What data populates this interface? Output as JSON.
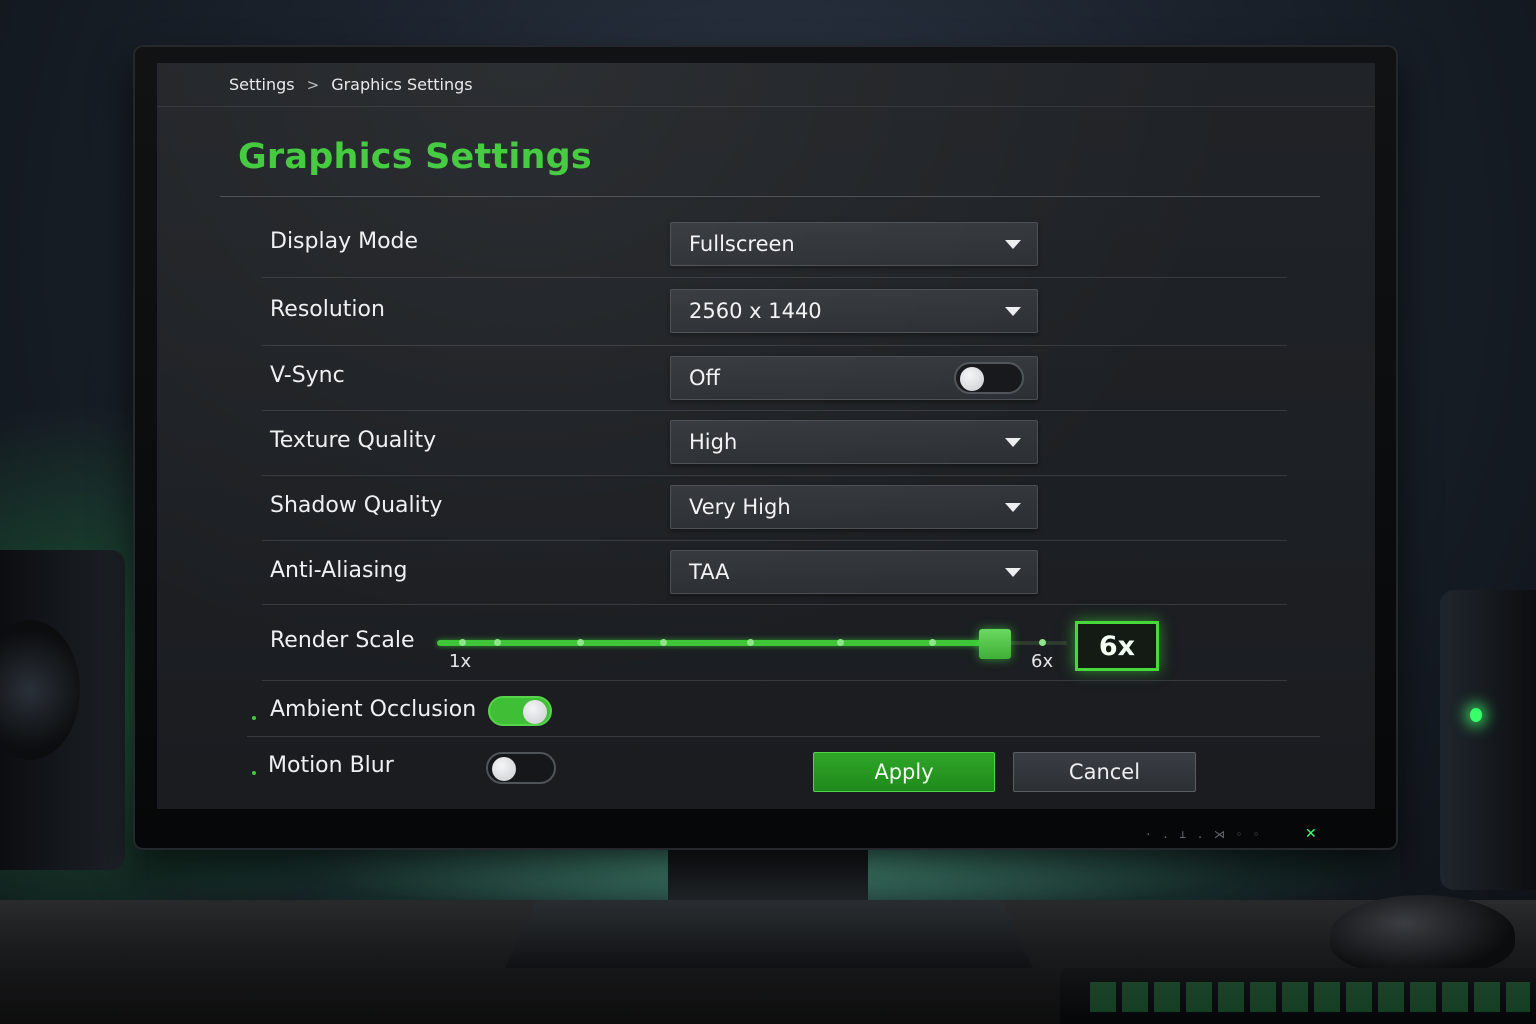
{
  "breadcrumb": {
    "root": "Settings",
    "separator": ">",
    "current": "Graphics Settings"
  },
  "page": {
    "title": "Graphics Settings"
  },
  "settings": {
    "display_mode": {
      "label": "Display Mode",
      "value": "Fullscreen"
    },
    "resolution": {
      "label": "Resolution",
      "value": "2560 x 1440"
    },
    "vsync": {
      "label": "V-Sync",
      "value": "Off",
      "enabled": false
    },
    "texture_quality": {
      "label": "Texture Quality",
      "value": "High"
    },
    "shadow_quality": {
      "label": "Shadow Quality",
      "value": "Very High"
    },
    "anti_aliasing": {
      "label": "Anti-Aliasing",
      "value": "TAA"
    },
    "render_scale": {
      "label": "Render Scale",
      "min_label": "1x",
      "max_label": "6x",
      "value_label": "6x",
      "position": 0.885
    },
    "ambient_occlusion": {
      "label": "Ambient Occlusion",
      "enabled": true
    },
    "motion_blur": {
      "label": "Motion Blur",
      "enabled": false
    }
  },
  "actions": {
    "apply_label": "Apply",
    "cancel_label": "Cancel"
  },
  "colors": {
    "accent": "#3fc93a",
    "background": "#1d2024",
    "text": "#eef0f2"
  },
  "icons": {
    "dropdown": "caret-down-icon",
    "breadcrumb_separator": "chevron-right-icon"
  }
}
